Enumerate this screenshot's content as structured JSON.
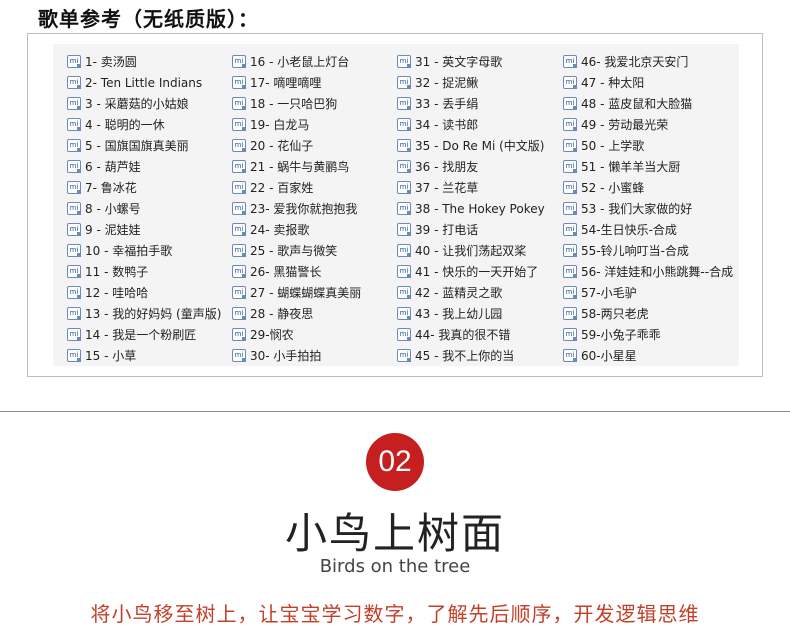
{
  "header": {
    "title": "歌单参考（无纸质版）："
  },
  "icon": {
    "name": "music-file-icon",
    "glyph": "mi"
  },
  "songs": {
    "col1": [
      "1- 卖汤圆",
      "2- Ten Little Indians",
      "3 - 采蘑菇的小姑娘",
      "4 - 聪明的一休",
      "5 - 国旗国旗真美丽",
      "6 - 葫芦娃",
      "7- 鲁冰花",
      "8 - 小螺号",
      "9 - 泥娃娃",
      "10 - 幸福拍手歌",
      "11 - 数鸭子",
      "12 - 哇哈哈",
      "13 - 我的好妈妈 (童声版)",
      "14 - 我是一个粉刷匠",
      "15 - 小草"
    ],
    "col2": [
      "16 - 小老鼠上灯台",
      "17- 嘀哩嘀哩",
      "18 - 一只哈巴狗",
      "19- 白龙马",
      "20 - 花仙子",
      "21 - 蜗牛与黄鹂鸟",
      "22 - 百家姓",
      "23- 爱我你就抱抱我",
      "24- 卖报歌",
      "25 - 歌声与微笑",
      "26- 黑猫警长",
      "27 - 蝴蝶蝴蝶真美丽",
      "28 - 静夜思",
      "29-悯农",
      "30- 小手拍拍"
    ],
    "col3": [
      "31 - 英文字母歌",
      "32 - 捉泥鳅",
      "33 - 丢手绢",
      "34 - 读书郎",
      "35 - Do Re Mi (中文版)",
      "36 - 找朋友",
      "37 - 兰花草",
      "38 - The Hokey Pokey",
      "39 - 打电话",
      "40 - 让我们荡起双桨",
      "41 - 快乐的一天开始了",
      "42 - 蓝精灵之歌",
      "43 - 我上幼儿园",
      "44- 我真的很不错",
      "45 - 我不上你的当"
    ],
    "col4": [
      "46- 我爱北京天安门",
      "47 - 种太阳",
      "48 - 蓝皮鼠和大脸猫",
      "49 - 劳动最光荣",
      "50 - 上学歌",
      "51 - 懒羊羊当大厨",
      "52 - 小蜜蜂",
      "53 - 我们大家做的好",
      "54-生日快乐-合成",
      "55-铃儿响叮当-合成",
      "56- 洋娃娃和小熊跳舞--合成",
      "57-小毛驴",
      "58-两只老虎",
      "59-小兔子乖乖",
      "60-小星星"
    ]
  },
  "section": {
    "number": "02",
    "title": "小鸟上树面",
    "subtitle": "Birds on the tree",
    "description": "将小鸟移至树上，让宝宝学习数字，了解先后顺序，开发逻辑思维"
  },
  "colors": {
    "badge": "#c51f1f",
    "description": "#c2402a",
    "icon": "#2b57a0"
  }
}
